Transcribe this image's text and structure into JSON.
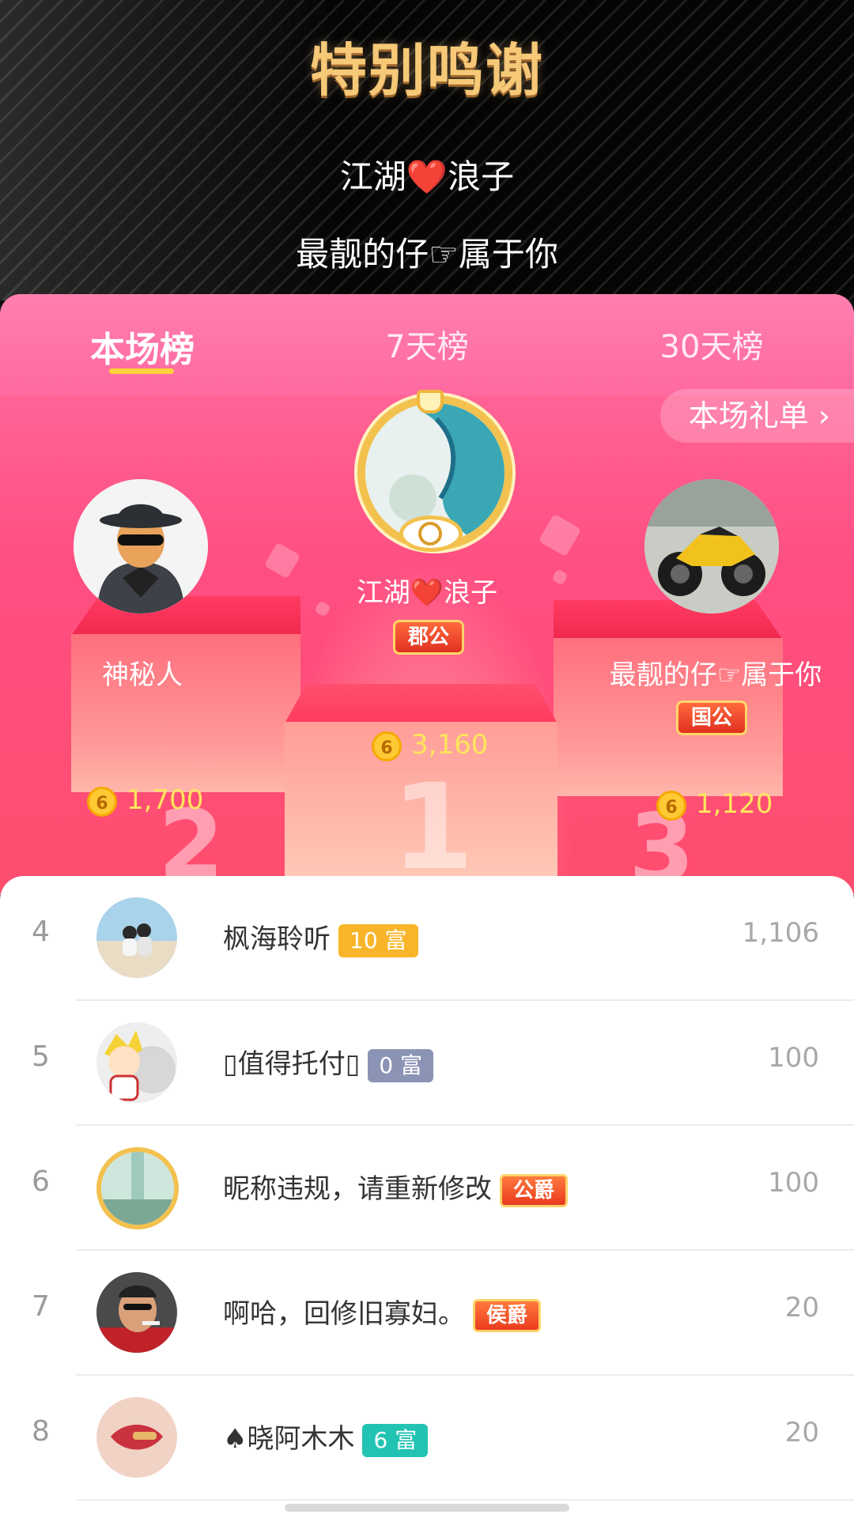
{
  "banner": {
    "title": "特别鸣谢",
    "line1": "江湖❤️浪子",
    "line2": "最靓的仔☞属于你"
  },
  "tabs": [
    {
      "label": "本场榜",
      "active": true
    },
    {
      "label": "7天榜",
      "active": false
    },
    {
      "label": "30天榜",
      "active": false
    }
  ],
  "gift_list_label": "本场礼单 ›",
  "top3": {
    "first": {
      "name": "江湖❤️浪子",
      "badge": "郡公",
      "score": "3,160",
      "podium": "1"
    },
    "second": {
      "name": "神秘人",
      "score": "1,700",
      "podium": "2"
    },
    "third": {
      "name": "最靓的仔☞属于你",
      "badge": "国公",
      "score": "1,120",
      "podium": "3"
    }
  },
  "coin_symbol": "6",
  "list": [
    {
      "rank": "4",
      "name": "枫海聆听",
      "tag": "10 富",
      "tag_style": "gold",
      "value": "1,106"
    },
    {
      "rank": "5",
      "name": "▯值得托付▯",
      "tag": "0 富",
      "tag_style": "grey",
      "value": "100"
    },
    {
      "rank": "6",
      "name": "昵称违规，请重新修改",
      "tag": "公爵",
      "tag_style": "title",
      "value": "100"
    },
    {
      "rank": "7",
      "name": "啊哈，回修旧寡妇。",
      "tag": "侯爵",
      "tag_style": "title",
      "value": "20"
    },
    {
      "rank": "8",
      "name": "♠晓阿木木",
      "tag": "6 富",
      "tag_style": "teal",
      "value": "20"
    }
  ],
  "colors": {
    "accent_pink": "#ff5a8c",
    "tab_underline": "#ffd23a",
    "score_yellow": "#ffe55c"
  }
}
